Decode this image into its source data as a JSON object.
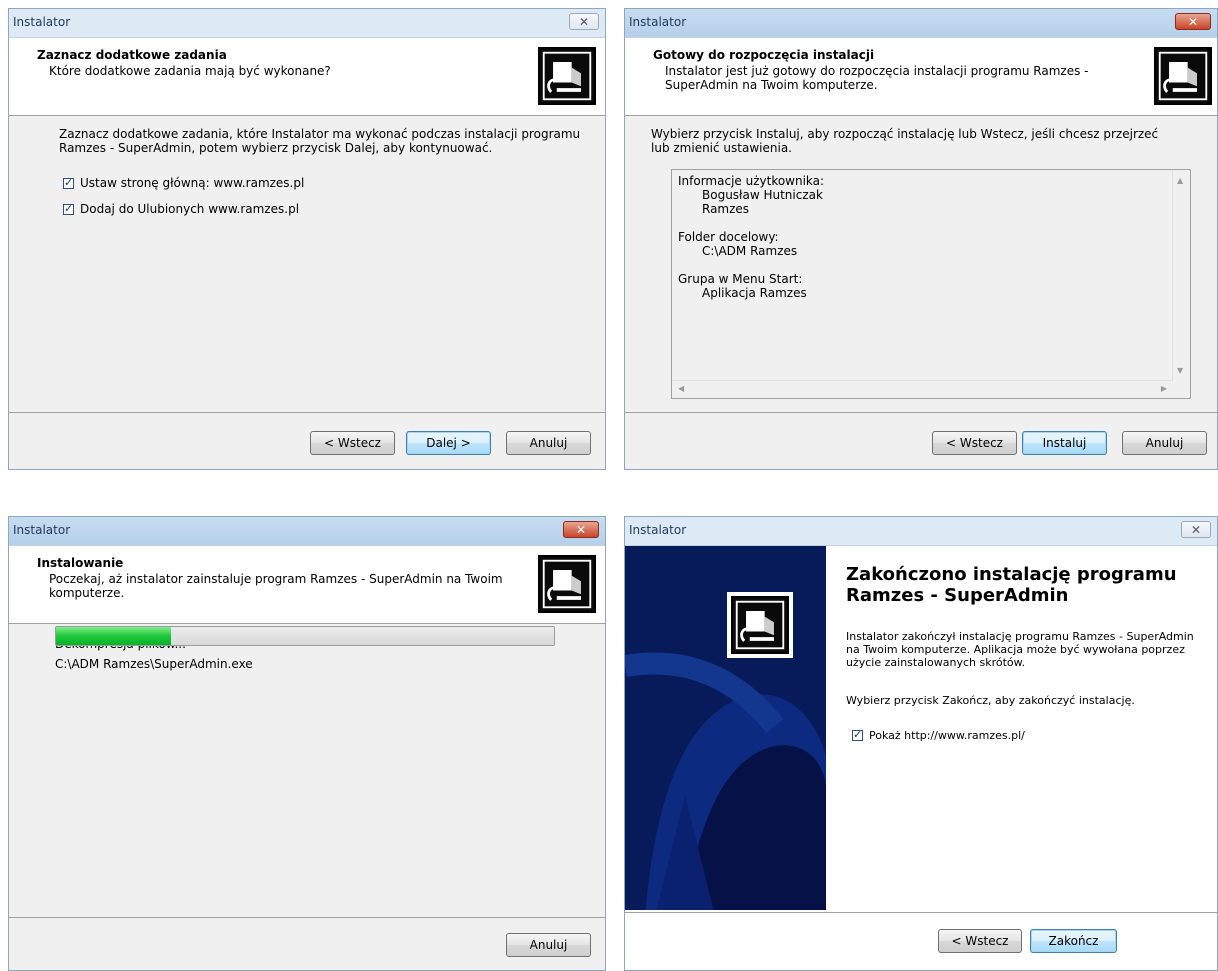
{
  "common": {
    "window_title": "Instalator",
    "close_glyph_plain": "✕",
    "close_glyph_red": "✕",
    "logo_icon": "computer-install-icon"
  },
  "win1": {
    "header_title": "Zaznacz dodatkowe zadania",
    "header_subtitle": "Które dodatkowe zadania mają być wykonane?",
    "body_line1": "Zaznacz dodatkowe zadania, które Instalator ma wykonać podczas instalacji programu",
    "body_line2": "Ramzes - SuperAdmin, potem wybierz przycisk Dalej, aby kontynuować.",
    "checkbox1": "Ustaw stronę główną: www.ramzes.pl",
    "checkbox2": "Dodaj do Ulubionych www.ramzes.pl",
    "back_button": "< Wstecz",
    "next_button": "Dalej >",
    "cancel_button": "Anuluj"
  },
  "win2": {
    "header_title": "Gotowy do rozpoczęcia instalacji",
    "header_subtitle_line1": "Instalator jest już gotowy do rozpoczęcia instalacji programu Ramzes -",
    "header_subtitle_line2": "SuperAdmin na Twoim komputerze.",
    "body_line1": "Wybierz przycisk Instaluj, aby rozpocząć instalację lub Wstecz, jeśli chcesz przejrzeć",
    "body_line2": "lub zmienić ustawienia.",
    "memo": {
      "user_label": "Informacje użytkownika:",
      "user_name": "Bogusław Hutniczak",
      "user_org": "Ramzes",
      "folder_label": "Folder docelowy:",
      "folder_value": "C:\\ADM Ramzes",
      "group_label": "Grupa w Menu Start:",
      "group_value": "Aplikacja Ramzes"
    },
    "back_button": "< Wstecz",
    "install_button": "Instaluj",
    "cancel_button": "Anuluj"
  },
  "win3": {
    "header_title": "Instalowanie",
    "header_subtitle_line1": "Poczekaj, aż instalator zainstaluje program Ramzes - SuperAdmin na Twoim",
    "header_subtitle_line2": "komputerze.",
    "status_line1": "Dekompresja plików...",
    "status_line2": "C:\\ADM Ramzes\\SuperAdmin.exe",
    "progress_fraction": 0.23,
    "cancel_button": "Anuluj"
  },
  "win4": {
    "title_line1": "Zakończono instalację programu",
    "title_line2": "Ramzes - SuperAdmin",
    "body_line1": "Instalator zakończył instalację programu Ramzes - SuperAdmin",
    "body_line2": "na Twoim komputerze. Aplikacja może być wywołana poprzez",
    "body_line3": "użycie zainstalowanych skrótów.",
    "body_line4": "Wybierz przycisk Zakończ, aby zakończyć instalację.",
    "checkbox": "Pokaż http://www.ramzes.pl/",
    "back_button": "< Wstecz",
    "finish_button": "Zakończ"
  }
}
